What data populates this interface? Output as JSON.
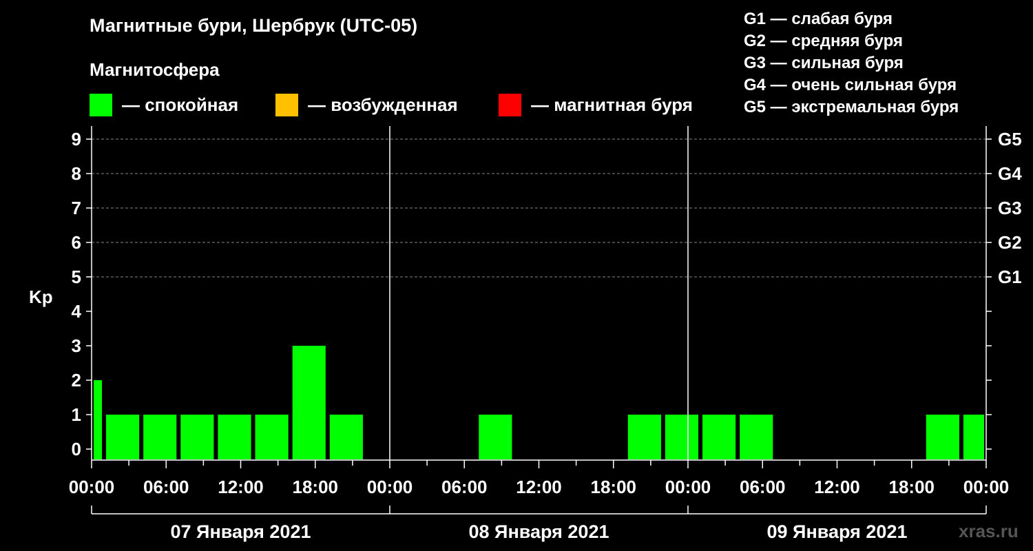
{
  "header": {
    "title": "Магнитные бури, Шербрук (UTC-05)",
    "subtitle": "Магнитосфера"
  },
  "legend": {
    "items": [
      {
        "label": "— спокойная",
        "color": "#00ff00"
      },
      {
        "label": "— возбужденная",
        "color": "#ffc000"
      },
      {
        "label": "— магнитная буря",
        "color": "#ff0000"
      }
    ],
    "storm_levels": [
      "G1 — слабая буря",
      "G2 — средняя буря",
      "G3 — сильная буря",
      "G4 — очень сильная буря",
      "G5 — экстремальная буря"
    ]
  },
  "watermark": "xras.ru",
  "chart_data": {
    "type": "bar",
    "ylabel": "Kp",
    "ylim": [
      0,
      9
    ],
    "yticks": [
      "0",
      "1",
      "2",
      "3",
      "4",
      "5",
      "6",
      "7",
      "8",
      "9"
    ],
    "right_ticks": [
      {
        "value": 5,
        "label": "G1"
      },
      {
        "value": 6,
        "label": "G2"
      },
      {
        "value": 7,
        "label": "G3"
      },
      {
        "value": 8,
        "label": "G4"
      },
      {
        "value": 9,
        "label": "G5"
      }
    ],
    "grid": "dashed horizontal at 5-9",
    "x_tick_labels": [
      "00:00",
      "06:00",
      "12:00",
      "18:00",
      "00:00",
      "06:00",
      "12:00",
      "18:00",
      "00:00",
      "06:00",
      "12:00",
      "18:00",
      "00:00"
    ],
    "days": [
      "07 Января 2021",
      "08 Января 2021",
      "09 Января 2021"
    ],
    "bars": [
      {
        "start_h": 0,
        "end_h": 1,
        "kp": 2
      },
      {
        "start_h": 1,
        "end_h": 4,
        "kp": 1
      },
      {
        "start_h": 4,
        "end_h": 7,
        "kp": 1
      },
      {
        "start_h": 7,
        "end_h": 10,
        "kp": 1
      },
      {
        "start_h": 10,
        "end_h": 13,
        "kp": 1
      },
      {
        "start_h": 13,
        "end_h": 16,
        "kp": 1
      },
      {
        "start_h": 16,
        "end_h": 19,
        "kp": 3
      },
      {
        "start_h": 19,
        "end_h": 22,
        "kp": 1
      },
      {
        "start_h": 31,
        "end_h": 34,
        "kp": 1
      },
      {
        "start_h": 43,
        "end_h": 46,
        "kp": 1
      },
      {
        "start_h": 46,
        "end_h": 49,
        "kp": 1
      },
      {
        "start_h": 49,
        "end_h": 52,
        "kp": 1
      },
      {
        "start_h": 52,
        "end_h": 55,
        "kp": 1
      },
      {
        "start_h": 67,
        "end_h": 70,
        "kp": 1
      },
      {
        "start_h": 70,
        "end_h": 72,
        "kp": 1
      }
    ],
    "bar_color": "#00ff00"
  }
}
